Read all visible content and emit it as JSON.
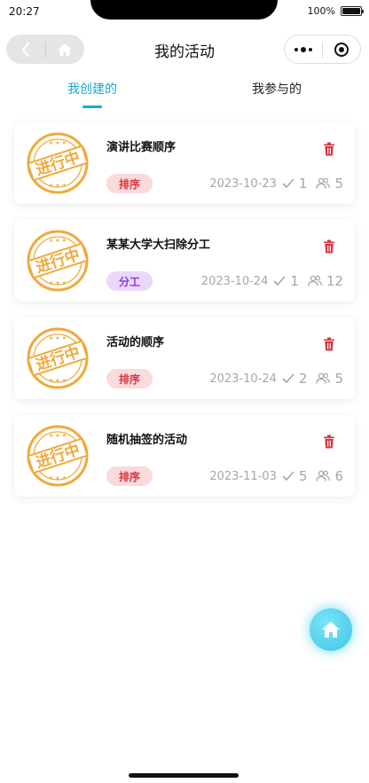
{
  "status_bar": {
    "time": "20:27",
    "battery": "100%",
    "battery_level": 1.0
  },
  "navbar": {
    "title": "我的活动"
  },
  "tabs": [
    {
      "label": "我创建的",
      "active": true
    },
    {
      "label": "我参与的",
      "active": false
    }
  ],
  "stamp_text": "进行中",
  "activities": [
    {
      "title": "演讲比赛顺序",
      "tag": "排序",
      "tag_type": "sort",
      "date": "2023-10-23",
      "done_count": "1",
      "people_count": "5"
    },
    {
      "title": "某某大学大扫除分工",
      "tag": "分工",
      "tag_type": "divide",
      "date": "2023-10-24",
      "done_count": "1",
      "people_count": "12"
    },
    {
      "title": "活动的顺序",
      "tag": "排序",
      "tag_type": "sort",
      "date": "2023-10-24",
      "done_count": "2",
      "people_count": "5"
    },
    {
      "title": "随机抽签的活动",
      "tag": "排序",
      "tag_type": "sort",
      "date": "2023-11-03",
      "done_count": "5",
      "people_count": "6"
    }
  ],
  "colors": {
    "accent": "#1aa7d8",
    "stamp": "#f0a93a",
    "delete": "#d9363e",
    "sort_tag_bg": "#fadadb",
    "divide_tag_bg": "#ead8fb",
    "fab": "#3fc5e6"
  },
  "icons": [
    "back-icon",
    "home-icon",
    "more-icon",
    "target-icon",
    "trash-icon",
    "check-icon",
    "people-icon"
  ]
}
